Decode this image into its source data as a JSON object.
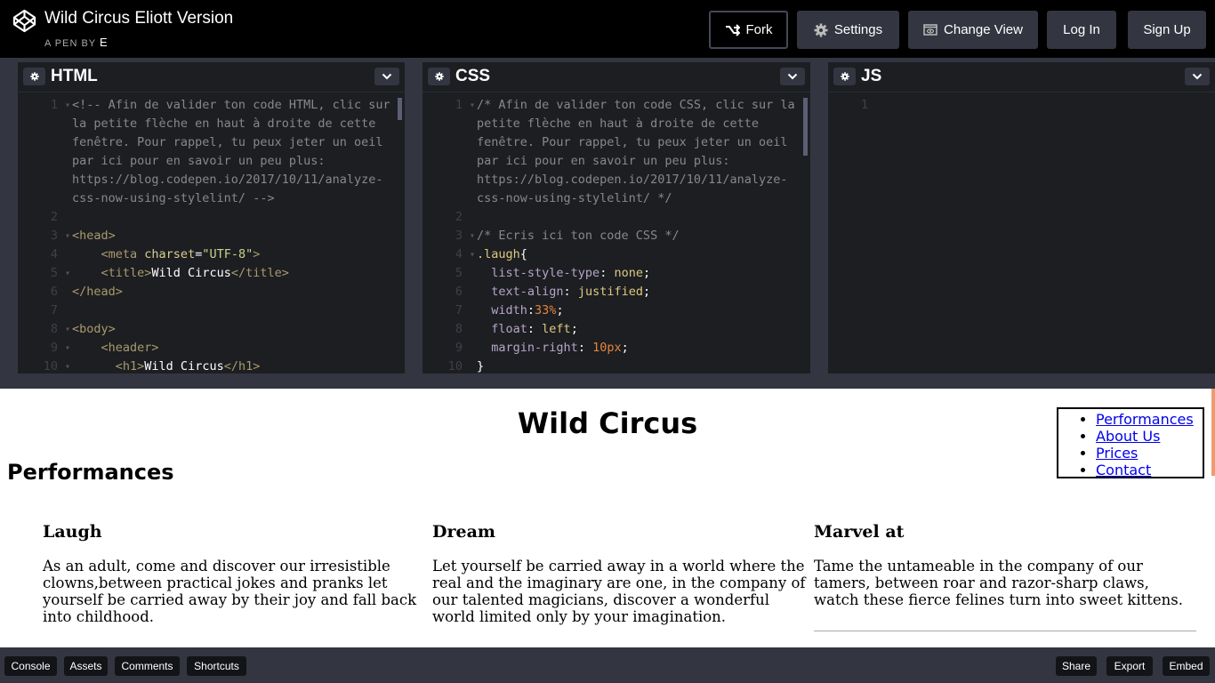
{
  "header": {
    "title": "Wild Circus Eliott Version",
    "byline_prefix": "A PEN BY",
    "author": "E",
    "buttons": {
      "fork": "Fork",
      "settings": "Settings",
      "change_view": "Change View",
      "login": "Log In",
      "signup": "Sign Up"
    }
  },
  "editors": {
    "html": {
      "title": "HTML",
      "lines": [
        {
          "n": "1",
          "fold": true,
          "segments": [
            {
              "c": "c-comment",
              "t": "<!-- Afin de valider ton code HTML, clic sur la petite flèche en haut à droite de cette fenêtre. Pour rappel, tu peux jeter un oeil par ici pour en savoir un peu plus: https://blog.codepen.io/2017/10/11/analyze-css-now-using-stylelint/ -->"
            }
          ]
        },
        {
          "n": "2",
          "fold": false,
          "segments": []
        },
        {
          "n": "3",
          "fold": true,
          "segments": [
            {
              "c": "c-tag",
              "t": "<head>"
            }
          ]
        },
        {
          "n": "4",
          "fold": false,
          "segments": [
            {
              "c": "",
              "t": "    "
            },
            {
              "c": "c-tag",
              "t": "<meta "
            },
            {
              "c": "c-attr",
              "t": "charset"
            },
            {
              "c": "c-white",
              "t": "="
            },
            {
              "c": "c-str",
              "t": "\"UTF-8\""
            },
            {
              "c": "c-tag",
              "t": ">"
            }
          ]
        },
        {
          "n": "5",
          "fold": true,
          "segments": [
            {
              "c": "",
              "t": "    "
            },
            {
              "c": "c-tag",
              "t": "<title>"
            },
            {
              "c": "c-white",
              "t": "Wild Circus"
            },
            {
              "c": "c-tag",
              "t": "</title>"
            }
          ]
        },
        {
          "n": "6",
          "fold": false,
          "segments": [
            {
              "c": "c-tag",
              "t": "</head>"
            }
          ]
        },
        {
          "n": "7",
          "fold": false,
          "segments": []
        },
        {
          "n": "8",
          "fold": true,
          "segments": [
            {
              "c": "c-tag",
              "t": "<body>"
            }
          ]
        },
        {
          "n": "9",
          "fold": true,
          "segments": [
            {
              "c": "",
              "t": "    "
            },
            {
              "c": "c-tag",
              "t": "<header>"
            }
          ]
        },
        {
          "n": "10",
          "fold": true,
          "segments": [
            {
              "c": "",
              "t": "      "
            },
            {
              "c": "c-tag",
              "t": "<h1>"
            },
            {
              "c": "c-white",
              "t": "Wild Circus"
            },
            {
              "c": "c-tag",
              "t": "</h1>"
            }
          ]
        }
      ]
    },
    "css": {
      "title": "CSS",
      "lines": [
        {
          "n": "1",
          "fold": true,
          "segments": [
            {
              "c": "c-comment",
              "t": "/* Afin de valider ton code CSS, clic sur la petite flèche en haut à droite de cette fenêtre. Pour rappel, tu peux jeter un oeil par ici pour en savoir un peu plus: https://blog.codepen.io/2017/10/11/analyze-css-now-using-stylelint/ */"
            }
          ]
        },
        {
          "n": "2",
          "fold": false,
          "segments": []
        },
        {
          "n": "3",
          "fold": true,
          "segments": [
            {
              "c": "c-comment",
              "t": "/* Ecris ici ton code CSS */"
            }
          ]
        },
        {
          "n": "4",
          "fold": true,
          "segments": [
            {
              "c": "c-sel",
              "t": ".laugh"
            },
            {
              "c": "c-white",
              "t": "{"
            }
          ]
        },
        {
          "n": "5",
          "fold": false,
          "segments": [
            {
              "c": "",
              "t": "  "
            },
            {
              "c": "c-prop",
              "t": "list-style-type"
            },
            {
              "c": "c-white",
              "t": ": "
            },
            {
              "c": "c-val",
              "t": "none"
            },
            {
              "c": "c-white",
              "t": ";"
            }
          ]
        },
        {
          "n": "6",
          "fold": false,
          "segments": [
            {
              "c": "",
              "t": "  "
            },
            {
              "c": "c-prop",
              "t": "text-align"
            },
            {
              "c": "c-white",
              "t": ": "
            },
            {
              "c": "c-val",
              "t": "justified"
            },
            {
              "c": "c-white",
              "t": ";"
            }
          ]
        },
        {
          "n": "7",
          "fold": false,
          "segments": [
            {
              "c": "",
              "t": "  "
            },
            {
              "c": "c-prop",
              "t": "width"
            },
            {
              "c": "c-white",
              "t": ":"
            },
            {
              "c": "c-num",
              "t": "33%"
            },
            {
              "c": "c-white",
              "t": ";"
            }
          ]
        },
        {
          "n": "8",
          "fold": false,
          "segments": [
            {
              "c": "",
              "t": "  "
            },
            {
              "c": "c-prop",
              "t": "float"
            },
            {
              "c": "c-white",
              "t": ": "
            },
            {
              "c": "c-val",
              "t": "left"
            },
            {
              "c": "c-white",
              "t": ";"
            }
          ]
        },
        {
          "n": "9",
          "fold": false,
          "segments": [
            {
              "c": "",
              "t": "  "
            },
            {
              "c": "c-prop",
              "t": "margin-right"
            },
            {
              "c": "c-white",
              "t": ": "
            },
            {
              "c": "c-num",
              "t": "10px"
            },
            {
              "c": "c-white",
              "t": ";"
            }
          ]
        },
        {
          "n": "10",
          "fold": false,
          "segments": [
            {
              "c": "c-white",
              "t": "}"
            }
          ]
        }
      ]
    },
    "js": {
      "title": "JS",
      "lines": [
        {
          "n": "1",
          "fold": false,
          "segments": []
        }
      ]
    }
  },
  "preview": {
    "title": "Wild Circus",
    "section_title": "Performances",
    "nav": [
      "Performances",
      "About Us",
      "Prices",
      "Contact"
    ],
    "columns": [
      {
        "title": "Laugh",
        "text": "As an adult, come and discover our irresistible clowns,between practical jokes and pranks let yourself be carried away by their joy and fall back into childhood."
      },
      {
        "title": "Dream",
        "text": "Let yourself be carried away in a world where the real and the imaginary are one, in the company of our talented magicians, discover a wonderful world limited only by your imagination."
      },
      {
        "title": "Marvel at",
        "text": "Tame the untameable in the company of our tamers, between roar and razor-sharp claws, watch these fierce felines turn into sweet kittens."
      }
    ]
  },
  "footer": {
    "left": [
      "Console",
      "Assets",
      "Comments",
      "Shortcuts"
    ],
    "right": [
      "Share",
      "Export",
      "Embed"
    ]
  }
}
